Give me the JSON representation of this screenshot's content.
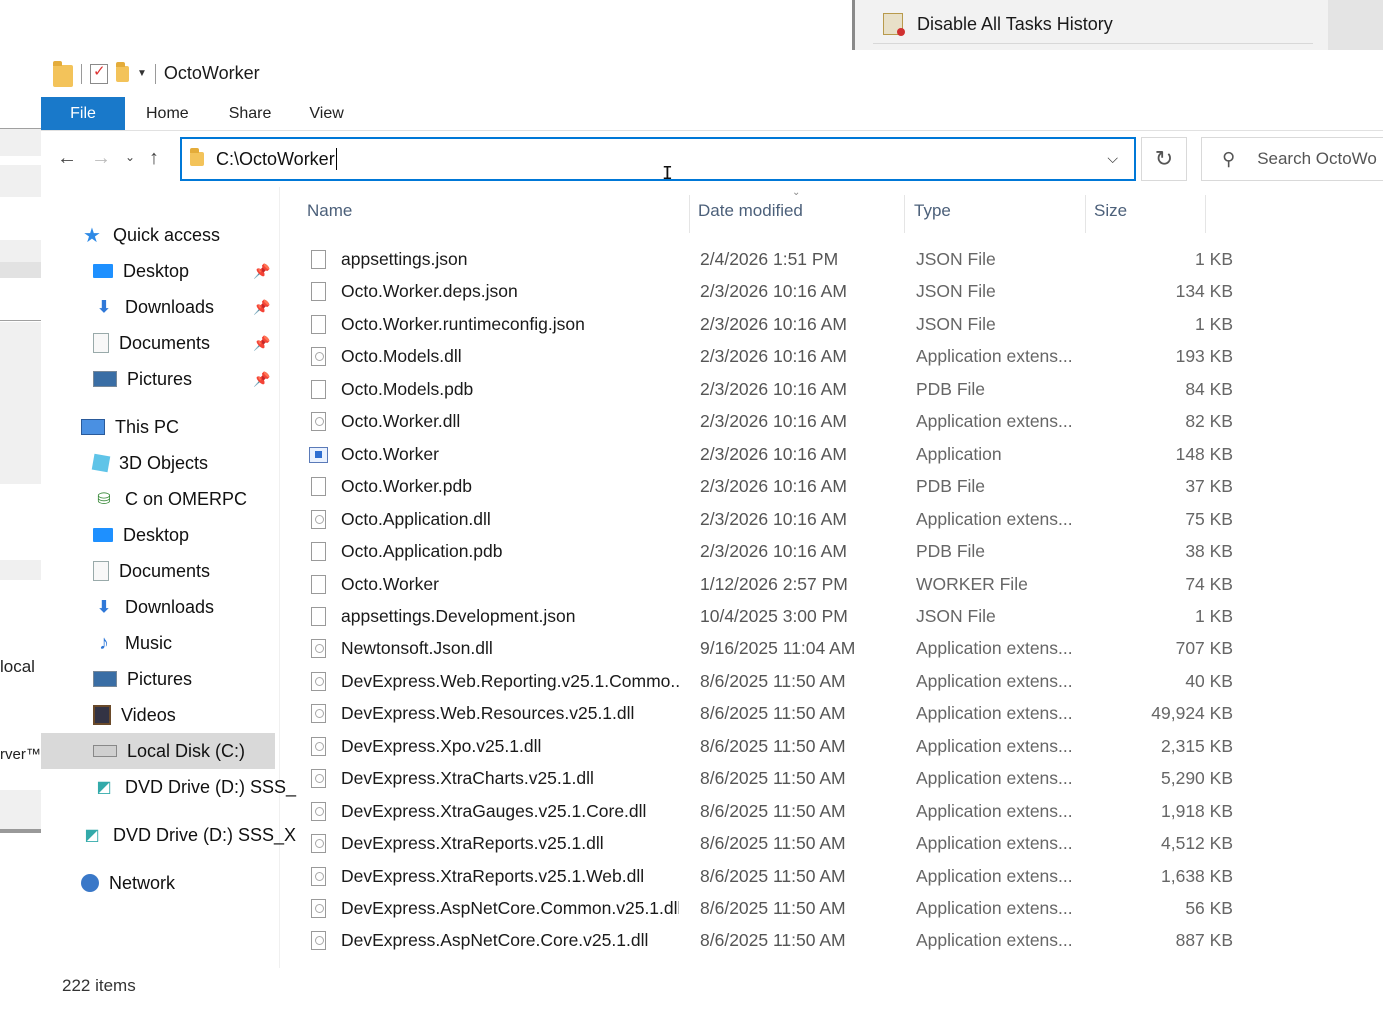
{
  "background": {
    "left_labels": [
      "local",
      "rver™"
    ],
    "menu_item": "Disable All Tasks History"
  },
  "window": {
    "title": "OctoWorker",
    "ribbon_tabs": [
      "File",
      "Home",
      "Share",
      "View"
    ],
    "address": "C:\\OctoWorker",
    "search_placeholder": "Search OctoWo",
    "status": "222 items"
  },
  "navpane": {
    "quick_access": "Quick access",
    "quick_items": [
      "Desktop",
      "Downloads",
      "Documents",
      "Pictures"
    ],
    "this_pc": "This PC",
    "pc_items": [
      "3D Objects",
      "C on OMERPC",
      "Desktop",
      "Documents",
      "Downloads",
      "Music",
      "Pictures",
      "Videos",
      "Local Disk (C:)",
      "DVD Drive (D:) SSS_"
    ],
    "dvd_root": "DVD Drive (D:) SSS_X",
    "network": "Network"
  },
  "columns": {
    "name": "Name",
    "date": "Date modified",
    "type": "Type",
    "size": "Size"
  },
  "files": [
    {
      "name": "appsettings.json",
      "date": "2/4/2026 1:51 PM",
      "type": "JSON File",
      "size": "1 KB",
      "icon": "generic"
    },
    {
      "name": "Octo.Worker.deps.json",
      "date": "2/3/2026 10:16 AM",
      "type": "JSON File",
      "size": "134 KB",
      "icon": "generic"
    },
    {
      "name": "Octo.Worker.runtimeconfig.json",
      "date": "2/3/2026 10:16 AM",
      "type": "JSON File",
      "size": "1 KB",
      "icon": "generic"
    },
    {
      "name": "Octo.Models.dll",
      "date": "2/3/2026 10:16 AM",
      "type": "Application extens...",
      "size": "193 KB",
      "icon": "dll"
    },
    {
      "name": "Octo.Models.pdb",
      "date": "2/3/2026 10:16 AM",
      "type": "PDB File",
      "size": "84 KB",
      "icon": "generic"
    },
    {
      "name": "Octo.Worker.dll",
      "date": "2/3/2026 10:16 AM",
      "type": "Application extens...",
      "size": "82 KB",
      "icon": "dll"
    },
    {
      "name": "Octo.Worker",
      "date": "2/3/2026 10:16 AM",
      "type": "Application",
      "size": "148 KB",
      "icon": "exe"
    },
    {
      "name": "Octo.Worker.pdb",
      "date": "2/3/2026 10:16 AM",
      "type": "PDB File",
      "size": "37 KB",
      "icon": "generic"
    },
    {
      "name": "Octo.Application.dll",
      "date": "2/3/2026 10:16 AM",
      "type": "Application extens...",
      "size": "75 KB",
      "icon": "dll"
    },
    {
      "name": "Octo.Application.pdb",
      "date": "2/3/2026 10:16 AM",
      "type": "PDB File",
      "size": "38 KB",
      "icon": "generic"
    },
    {
      "name": "Octo.Worker",
      "date": "1/12/2026 2:57 PM",
      "type": "WORKER File",
      "size": "74 KB",
      "icon": "generic"
    },
    {
      "name": "appsettings.Development.json",
      "date": "10/4/2025 3:00 PM",
      "type": "JSON File",
      "size": "1 KB",
      "icon": "generic"
    },
    {
      "name": "Newtonsoft.Json.dll",
      "date": "9/16/2025 11:04 AM",
      "type": "Application extens...",
      "size": "707 KB",
      "icon": "dll"
    },
    {
      "name": "DevExpress.Web.Reporting.v25.1.Commo...",
      "date": "8/6/2025 11:50 AM",
      "type": "Application extens...",
      "size": "40 KB",
      "icon": "dll"
    },
    {
      "name": "DevExpress.Web.Resources.v25.1.dll",
      "date": "8/6/2025 11:50 AM",
      "type": "Application extens...",
      "size": "49,924 KB",
      "icon": "dll"
    },
    {
      "name": "DevExpress.Xpo.v25.1.dll",
      "date": "8/6/2025 11:50 AM",
      "type": "Application extens...",
      "size": "2,315 KB",
      "icon": "dll"
    },
    {
      "name": "DevExpress.XtraCharts.v25.1.dll",
      "date": "8/6/2025 11:50 AM",
      "type": "Application extens...",
      "size": "5,290 KB",
      "icon": "dll"
    },
    {
      "name": "DevExpress.XtraGauges.v25.1.Core.dll",
      "date": "8/6/2025 11:50 AM",
      "type": "Application extens...",
      "size": "1,918 KB",
      "icon": "dll"
    },
    {
      "name": "DevExpress.XtraReports.v25.1.dll",
      "date": "8/6/2025 11:50 AM",
      "type": "Application extens...",
      "size": "4,512 KB",
      "icon": "dll"
    },
    {
      "name": "DevExpress.XtraReports.v25.1.Web.dll",
      "date": "8/6/2025 11:50 AM",
      "type": "Application extens...",
      "size": "1,638 KB",
      "icon": "dll"
    },
    {
      "name": "DevExpress.AspNetCore.Common.v25.1.dll",
      "date": "8/6/2025 11:50 AM",
      "type": "Application extens...",
      "size": "56 KB",
      "icon": "dll"
    },
    {
      "name": "DevExpress.AspNetCore.Core.v25.1.dll",
      "date": "8/6/2025 11:50 AM",
      "type": "Application extens...",
      "size": "887 KB",
      "icon": "dll"
    }
  ]
}
